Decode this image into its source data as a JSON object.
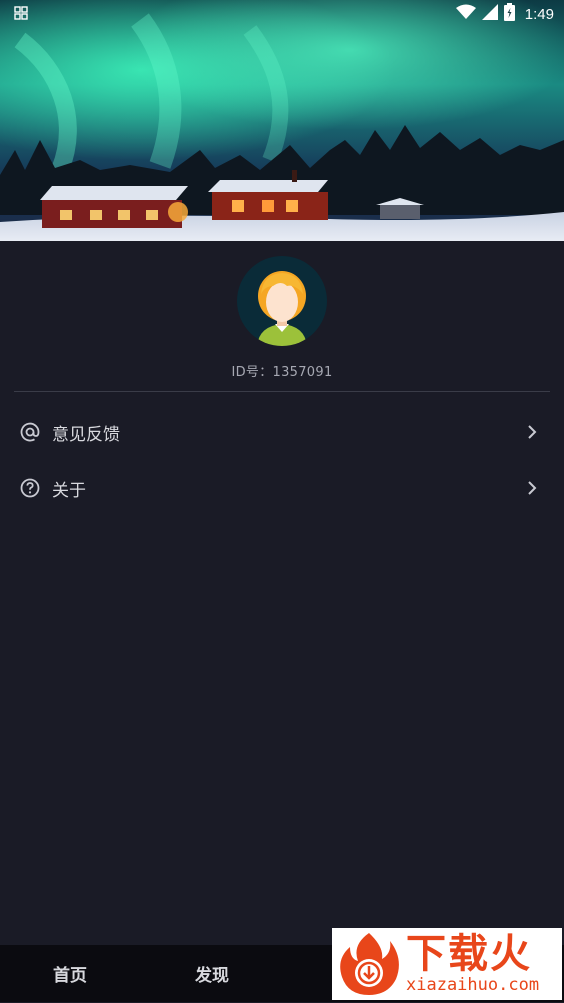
{
  "status_bar": {
    "time": "1:49",
    "icons": [
      "notification-grid-icon",
      "wifi-icon",
      "signal-icon",
      "battery-icon"
    ]
  },
  "profile": {
    "id_text": "ID号：1357091"
  },
  "menu": {
    "items": [
      {
        "label": "意见反馈",
        "icon": "at-icon"
      },
      {
        "label": "关于",
        "icon": "question-circle-icon"
      }
    ]
  },
  "bottom_nav": {
    "items": [
      {
        "label": "首页"
      },
      {
        "label": "发现"
      }
    ]
  },
  "watermark": {
    "brand": "下载火",
    "url": "xiazaihuo.com"
  },
  "colors": {
    "background": "#1a1b26",
    "bottom_nav": "#0b0b10",
    "aurora": "#2fd6a8",
    "watermark_accent": "#e8461a"
  }
}
